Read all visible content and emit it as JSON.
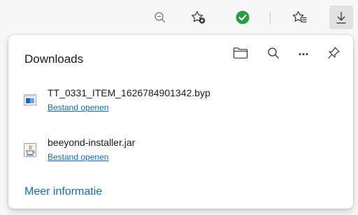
{
  "toolbar": {
    "icons": [
      "zoom-out-icon",
      "add-favorite-icon",
      "extension-check-icon",
      "favorites-icon",
      "downloads-icon"
    ],
    "accent_green": "#2a9d44"
  },
  "downloads_panel": {
    "title": "Downloads",
    "header_icons": [
      "folder-icon",
      "search-icon",
      "more-icon",
      "pin-icon"
    ],
    "more_glyph": "···",
    "items": [
      {
        "file_name": "TT_0331_ITEM_1626784901342.byp",
        "action_label": "Bestand openen",
        "icon": "byp-file-icon"
      },
      {
        "file_name": "beeyond-installer.jar",
        "action_label": "Bestand openen",
        "icon": "java-jar-icon"
      }
    ],
    "footer_link": "Meer informatie"
  },
  "colors": {
    "link": "#0f6cbd",
    "text": "#1b1b1b",
    "toolbar_bg": "#f7f7f7",
    "panel_bg": "#ffffff"
  }
}
